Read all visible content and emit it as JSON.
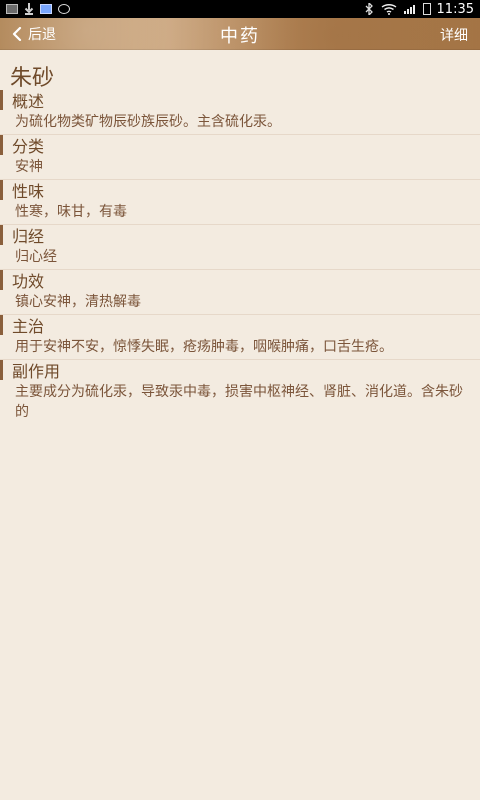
{
  "statusbar": {
    "time": "11:35",
    "icons_left": [
      "image-icon",
      "download-icon",
      "blue-app-icon",
      "round-app-icon"
    ],
    "icons_right": [
      "bluetooth-icon",
      "wifi-icon",
      "signal-icon",
      "battery-icon"
    ]
  },
  "header": {
    "back_label": "后退",
    "title": "中药",
    "detail_label": "详细"
  },
  "herb": {
    "name": "朱砂",
    "sections": [
      {
        "title": "概述",
        "text": "为硫化物类矿物辰砂族辰砂。主含硫化汞。"
      },
      {
        "title": "分类",
        "text": "安神"
      },
      {
        "title": "性味",
        "text": "性寒，味甘，有毒"
      },
      {
        "title": "归经",
        "text": "归心经"
      },
      {
        "title": "功效",
        "text": "镇心安神，清热解毒"
      },
      {
        "title": "主治",
        "text": "用于安神不安，惊悸失眠，疮疡肿毒，咽喉肿痛，口舌生疮。"
      },
      {
        "title": "副作用",
        "text": "主要成分为硫化汞，导致汞中毒，损害中枢神经、肾脏、消化道。含朱砂的"
      }
    ]
  },
  "colors": {
    "background": "#f3ebe0",
    "accent": "#8a5f3c",
    "text": "#7b553a"
  }
}
